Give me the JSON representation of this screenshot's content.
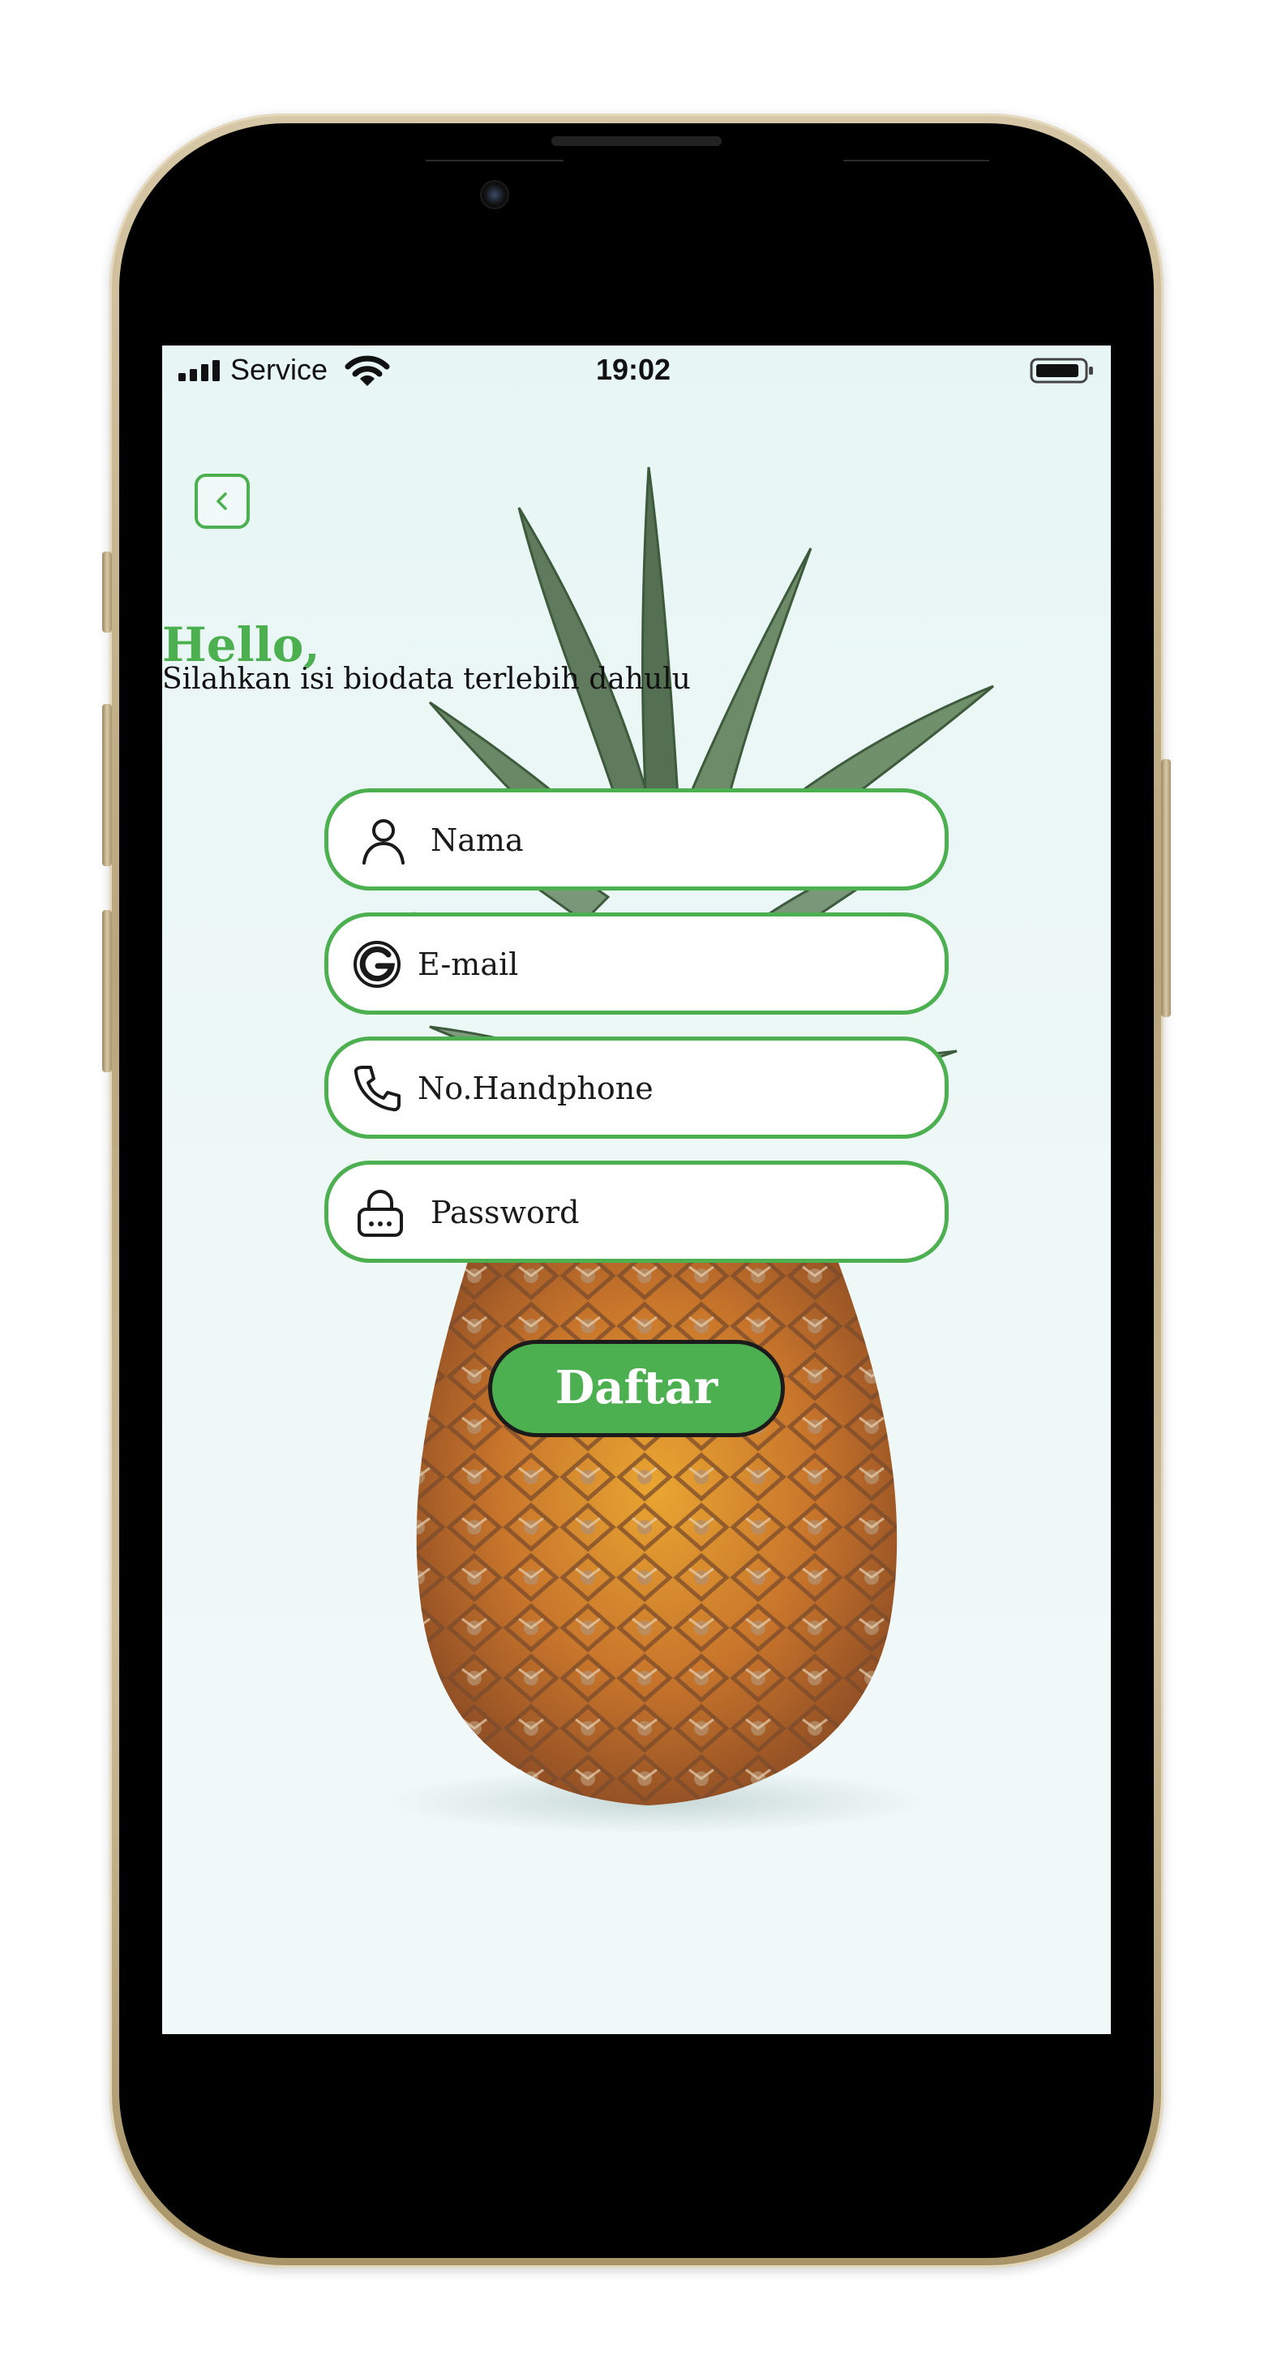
{
  "status_bar": {
    "carrier": "Service",
    "time": "19:02",
    "signal_icon": "cellular-signal-icon",
    "wifi_icon": "wifi-icon",
    "battery_icon": "battery-icon"
  },
  "header": {
    "back_icon": "chevron-left-icon",
    "greeting": "Hello,",
    "subtitle": "Silahkan isi biodata terlebih dahulu"
  },
  "form": {
    "fields": [
      {
        "icon": "user-icon",
        "placeholder": "Nama"
      },
      {
        "icon": "google-icon",
        "placeholder": "E-mail"
      },
      {
        "icon": "phone-icon",
        "placeholder": "No.Handphone"
      },
      {
        "icon": "lock-icon",
        "placeholder": "Password"
      }
    ],
    "submit_label": "Daftar"
  },
  "colors": {
    "accent": "#4caf50",
    "background": "#e9f6f5",
    "text": "#111111"
  }
}
